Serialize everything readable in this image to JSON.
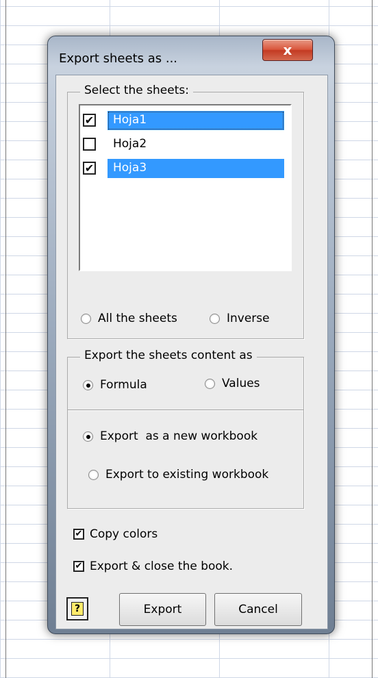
{
  "dialog": {
    "title": "Export sheets as ...",
    "close_label": "x"
  },
  "sheets_group": {
    "legend": "Select the sheets:",
    "items": [
      {
        "label": "Hoja1",
        "checked": true,
        "selected": true
      },
      {
        "label": "Hoja2",
        "checked": false,
        "selected": false
      },
      {
        "label": "Hoja3",
        "checked": true,
        "selected": true
      }
    ],
    "all_label": "All the sheets",
    "inverse_label": "Inverse"
  },
  "content_group": {
    "legend": "Export the sheets content as",
    "formula_label": "Formula",
    "values_label": "Values",
    "selected": "formula"
  },
  "export_group": {
    "new_label": "Export  as a new workbook",
    "existing_label": "Export to existing workbook",
    "selected": "new"
  },
  "options": {
    "copy_colors_label": "Copy colors",
    "copy_colors_checked": true,
    "close_book_label": "Export & close the book.",
    "close_book_checked": true
  },
  "buttons": {
    "help_label": "?",
    "export_label": "Export",
    "cancel_label": "Cancel"
  },
  "check_glyph": "✔"
}
